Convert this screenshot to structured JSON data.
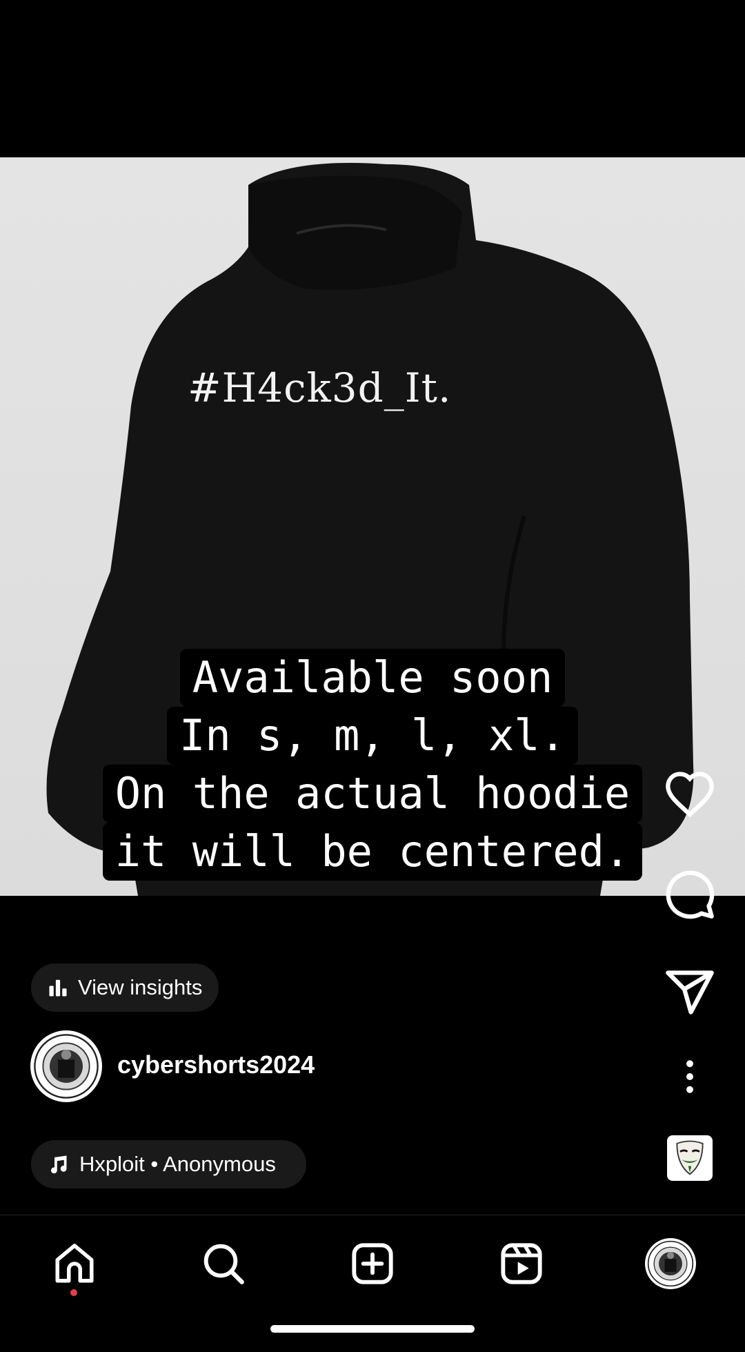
{
  "post": {
    "shirt_print": "#H4ck3d_It.",
    "caption_lines": [
      "Available soon",
      "In s, m, l, xl.",
      "On the actual hoodie",
      "it will be centered."
    ]
  },
  "actions": {
    "insights_label": "View insights",
    "username": "cybershorts2024",
    "audio_label": "Hxploit • Anonymous"
  },
  "icons": {
    "like": "heart-icon",
    "comment": "comment-icon",
    "share": "send-icon",
    "more": "more-icon",
    "audio_thumb": "mask-icon"
  },
  "nav": [
    "home-icon",
    "search-icon",
    "create-icon",
    "reels-icon",
    "profile-icon"
  ],
  "colors": {
    "background": "#000000",
    "pill": "#1a1a1a",
    "notification_dot": "#e0404a"
  }
}
